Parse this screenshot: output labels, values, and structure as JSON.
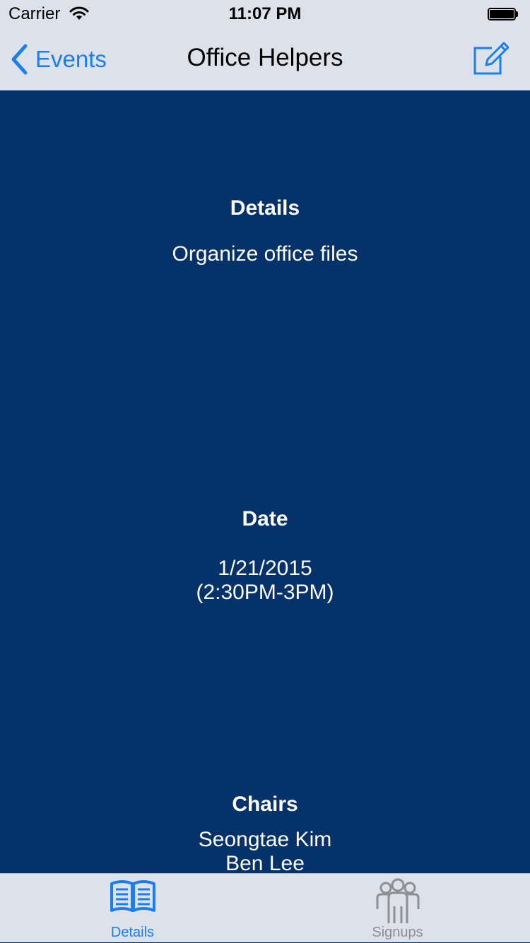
{
  "status_bar": {
    "carrier": "Carrier",
    "time": "11:07 PM"
  },
  "nav": {
    "back_label": "Events",
    "title": "Office Helpers",
    "compose_icon": "compose-icon"
  },
  "sections": {
    "details": {
      "heading": "Details",
      "text": "Organize office files"
    },
    "date": {
      "heading": "Date",
      "date": "1/21/2015",
      "time_range": "(2:30PM-3PM)"
    },
    "chairs": {
      "heading": "Chairs",
      "names": [
        "Seongtae Kim",
        "Ben Lee"
      ]
    }
  },
  "tabbar": {
    "tabs": [
      {
        "label": "Details",
        "icon": "book-icon",
        "selected": true
      },
      {
        "label": "Signups",
        "icon": "group-icon",
        "selected": false
      }
    ]
  },
  "colors": {
    "accent": "#1a7ef0",
    "background": "#06326a",
    "bar": "#dde2ea",
    "tab_inactive": "#8e8e93"
  }
}
